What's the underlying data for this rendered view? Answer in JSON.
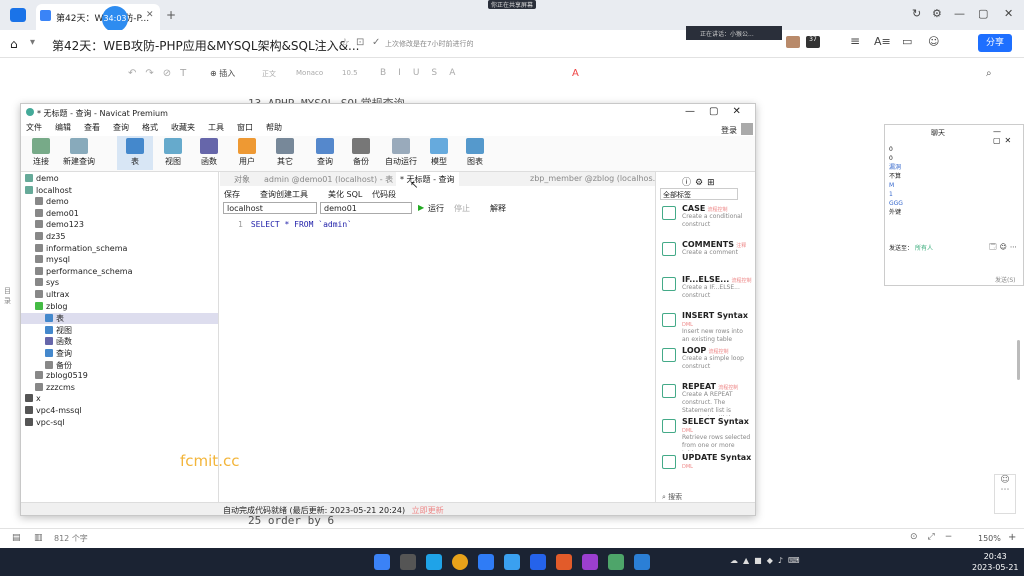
{
  "browser": {
    "tab_title": "第42天：WEB攻防-P...",
    "timer": "34:03",
    "doc_title": "第42天：WEB攻防-PHP应用&MYSQL架构&SQL注入&...",
    "save_status": "上次修改是在7小时前进行的",
    "share_label": "分享",
    "top_banner": "你正在共享屏幕",
    "mic_status": "正在讲话：小猴公..."
  },
  "doc_toolbar": {
    "insert_label": "插入",
    "style": "正文",
    "font": "Monaco",
    "size": "10.5"
  },
  "doc_bg": {
    "line13": "13   APHP-MYSQL-SQL常规查询",
    "line25": "25   order by 6"
  },
  "navicat": {
    "title": "* 无标题 - 查询 - Navicat Premium",
    "login": "登录",
    "menu": [
      "文件",
      "编辑",
      "查看",
      "查询",
      "格式",
      "收藏夹",
      "工具",
      "窗口",
      "帮助"
    ],
    "ribbon": [
      "连接",
      "新建查询",
      "表",
      "视图",
      "函数",
      "用户",
      "其它",
      "查询",
      "备份",
      "自动运行",
      "模型",
      "图表"
    ],
    "tree": [
      {
        "label": "demo",
        "indent": 0,
        "color": "#6a9"
      },
      {
        "label": "localhost",
        "indent": 0,
        "color": "#6a9"
      },
      {
        "label": "demo",
        "indent": 1,
        "color": "#888"
      },
      {
        "label": "demo01",
        "indent": 1,
        "color": "#888"
      },
      {
        "label": "demo123",
        "indent": 1,
        "color": "#888"
      },
      {
        "label": "dz35",
        "indent": 1,
        "color": "#888"
      },
      {
        "label": "information_schema",
        "indent": 1,
        "color": "#888"
      },
      {
        "label": "mysql",
        "indent": 1,
        "color": "#888"
      },
      {
        "label": "performance_schema",
        "indent": 1,
        "color": "#888"
      },
      {
        "label": "sys",
        "indent": 1,
        "color": "#888"
      },
      {
        "label": "ultrax",
        "indent": 1,
        "color": "#888"
      },
      {
        "label": "zblog",
        "indent": 1,
        "color": "#4b4"
      },
      {
        "label": "表",
        "indent": 2,
        "color": "#48c"
      },
      {
        "label": "视图",
        "indent": 2,
        "color": "#48c"
      },
      {
        "label": "函数",
        "indent": 2,
        "color": "#66a"
      },
      {
        "label": "查询",
        "indent": 2,
        "color": "#48c"
      },
      {
        "label": "备份",
        "indent": 2,
        "color": "#888"
      },
      {
        "label": "zblog0519",
        "indent": 1,
        "color": "#888"
      },
      {
        "label": "zzzcms",
        "indent": 1,
        "color": "#888"
      },
      {
        "label": "x",
        "indent": 0,
        "color": "#555"
      },
      {
        "label": "vpc4-mssql",
        "indent": 0,
        "color": "#555"
      },
      {
        "label": "vpc-sql",
        "indent": 0,
        "color": "#555"
      }
    ],
    "object_tabs": [
      "对象",
      "admin @demo01 (localhost) - 表",
      "* 无标题 - 查询",
      "zbp_member @zblog (localhos..."
    ],
    "editor_toolbar": [
      "保存",
      "查询创建工具",
      "美化 SQL",
      "代码段"
    ],
    "connection": "localhost",
    "database": "demo01",
    "run_label": "运行",
    "stop_label": "停止",
    "explain_label": "解释",
    "sql_line_no": "1",
    "sql_text": "SELECT * FROM `admin`",
    "snippet_filter": "全部标签",
    "snippets": [
      {
        "name": "CASE",
        "tag": "流程控制",
        "desc": "Create a conditional construct"
      },
      {
        "name": "COMMENTS",
        "tag": "注释",
        "desc": "Create a comment"
      },
      {
        "name": "IF...ELSE...",
        "tag": "流程控制",
        "desc": "Create a IF...ELSE... construct"
      },
      {
        "name": "INSERT Syntax",
        "tag": "DML",
        "desc": "Insert new rows into an existing table"
      },
      {
        "name": "LOOP",
        "tag": "流程控制",
        "desc": "Create a simple loop construct"
      },
      {
        "name": "REPEAT",
        "tag": "流程控制",
        "desc": "Create A REPEAT construct. The Statement list is repeated until the search_condition expression is true."
      },
      {
        "name": "SELECT Syntax",
        "tag": "DML",
        "desc": "Retrieve rows selected from one or more tables"
      },
      {
        "name": "UPDATE Syntax",
        "tag": "DML",
        "desc": ""
      }
    ],
    "search_label": "搜索",
    "status_text": "自动完成代码就绪 (最后更新: 2023-05-21 20:24)",
    "status_link": "立即更新"
  },
  "chat": {
    "title": "聊天",
    "lines": [
      "0",
      "0",
      "漏洞",
      "不算",
      "M",
      "1",
      "GGG",
      "外键"
    ],
    "send_to_label": "发送至：",
    "send_to_value": "所有人",
    "send_button": "发送(S)"
  },
  "bottom_bar": {
    "word_count": "812 个字",
    "zoom": "150%"
  },
  "taskbar": {
    "time": "20:43",
    "date": "2023-05-21"
  },
  "watermark": "fcmit.cc"
}
